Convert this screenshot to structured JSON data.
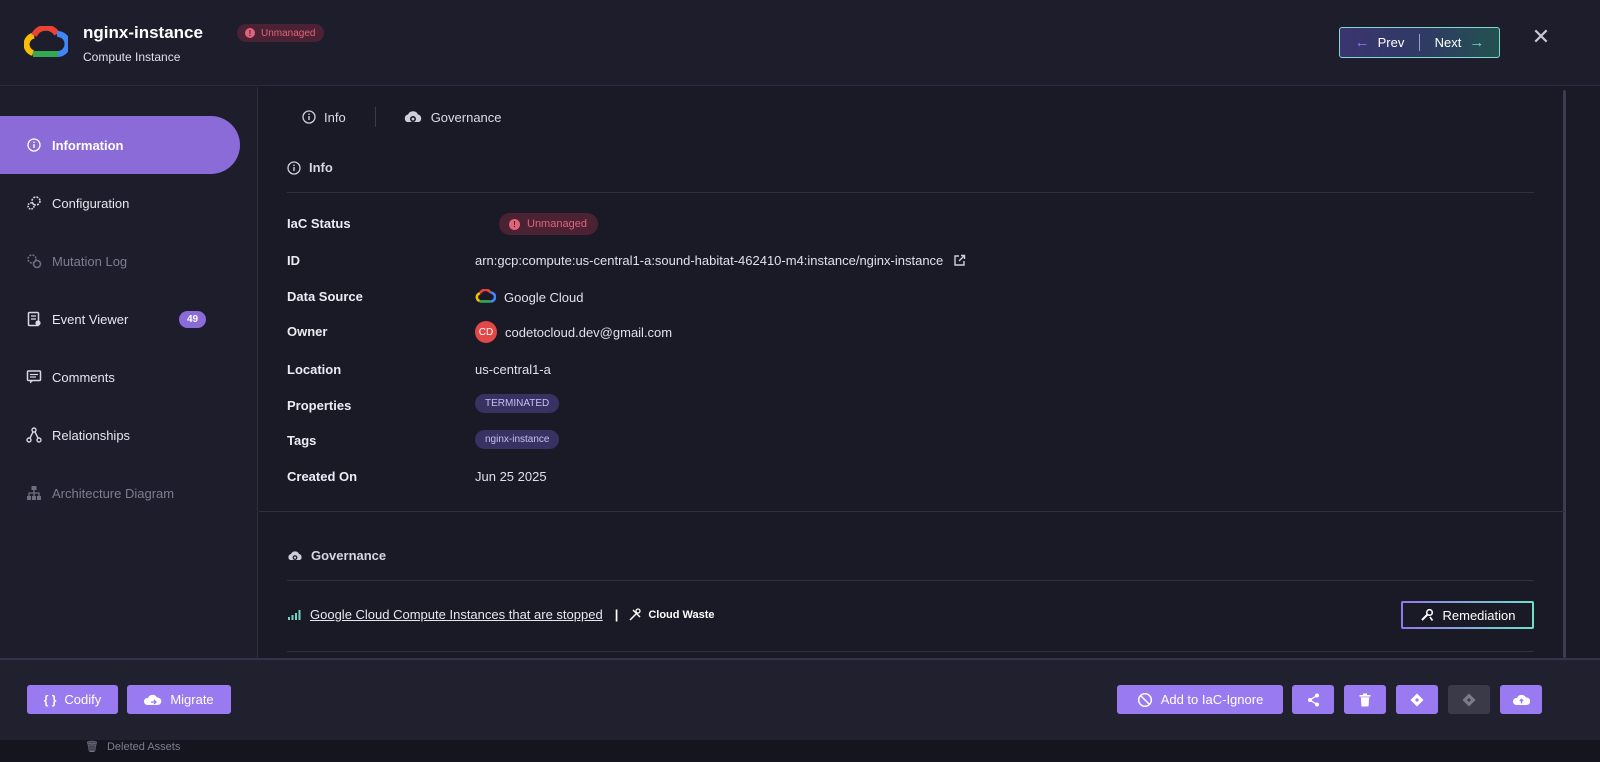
{
  "header": {
    "title": "nginx-instance",
    "subtitle": "Compute Instance",
    "status_badge": "Unmanaged",
    "prev_label": "Prev",
    "next_label": "Next",
    "close_symbol": "✕",
    "logo": "google-cloud-logo"
  },
  "sidebar": {
    "items": [
      {
        "label": "Information",
        "icon": "info-icon",
        "active": true
      },
      {
        "label": "Configuration",
        "icon": "gears-icon"
      },
      {
        "label": "Mutation Log",
        "icon": "mutation-icon",
        "dimmed": true
      },
      {
        "label": "Event Viewer",
        "icon": "event-viewer-icon",
        "count": "49"
      },
      {
        "label": "Comments",
        "icon": "comments-icon"
      },
      {
        "label": "Relationships",
        "icon": "relationships-icon"
      },
      {
        "label": "Architecture Diagram",
        "icon": "architecture-icon",
        "dimmed": true
      }
    ]
  },
  "tabs": [
    {
      "label": "Info",
      "icon": "info-icon"
    },
    {
      "label": "Governance",
      "icon": "governance-icon"
    }
  ],
  "info": {
    "section_title": "Info",
    "labels": {
      "iac_status": "IaC Status",
      "id": "ID",
      "data_source": "Data Source",
      "owner": "Owner",
      "location": "Location",
      "properties": "Properties",
      "tags": "Tags",
      "created_on": "Created On"
    },
    "values": {
      "iac_status": "Unmanaged",
      "id": "arn:gcp:compute:us-central1-a:sound-habitat-462410-m4:instance/nginx-instance",
      "data_source": "Google Cloud",
      "owner_initials": "CD",
      "owner": "codetocloud.dev@gmail.com",
      "location": "us-central1-a",
      "properties": "TERMINATED",
      "tags": "nginx-instance",
      "created_on": "Jun 25 2025"
    }
  },
  "governance": {
    "section_title": "Governance",
    "policy_link": "Google Cloud Compute Instances that are stopped",
    "separator": "|",
    "category": "Cloud Waste",
    "remediation_label": "Remediation"
  },
  "footer": {
    "codify_label": "Codify",
    "codify_icon": "{ }",
    "migrate_label": "Migrate",
    "iac_ignore_label": "Add to IaC-Ignore",
    "icons": [
      "share-icon",
      "trash-icon",
      "git-diamond-icon",
      "git-icon-disabled",
      "cloud-upload-icon"
    ],
    "deleted_assets": "Deleted Assets"
  },
  "colors": {
    "accent": "#8a6bd8",
    "button": "#9a7af0",
    "unmanaged": "#e0647a",
    "teal": "#6fd6c7"
  }
}
